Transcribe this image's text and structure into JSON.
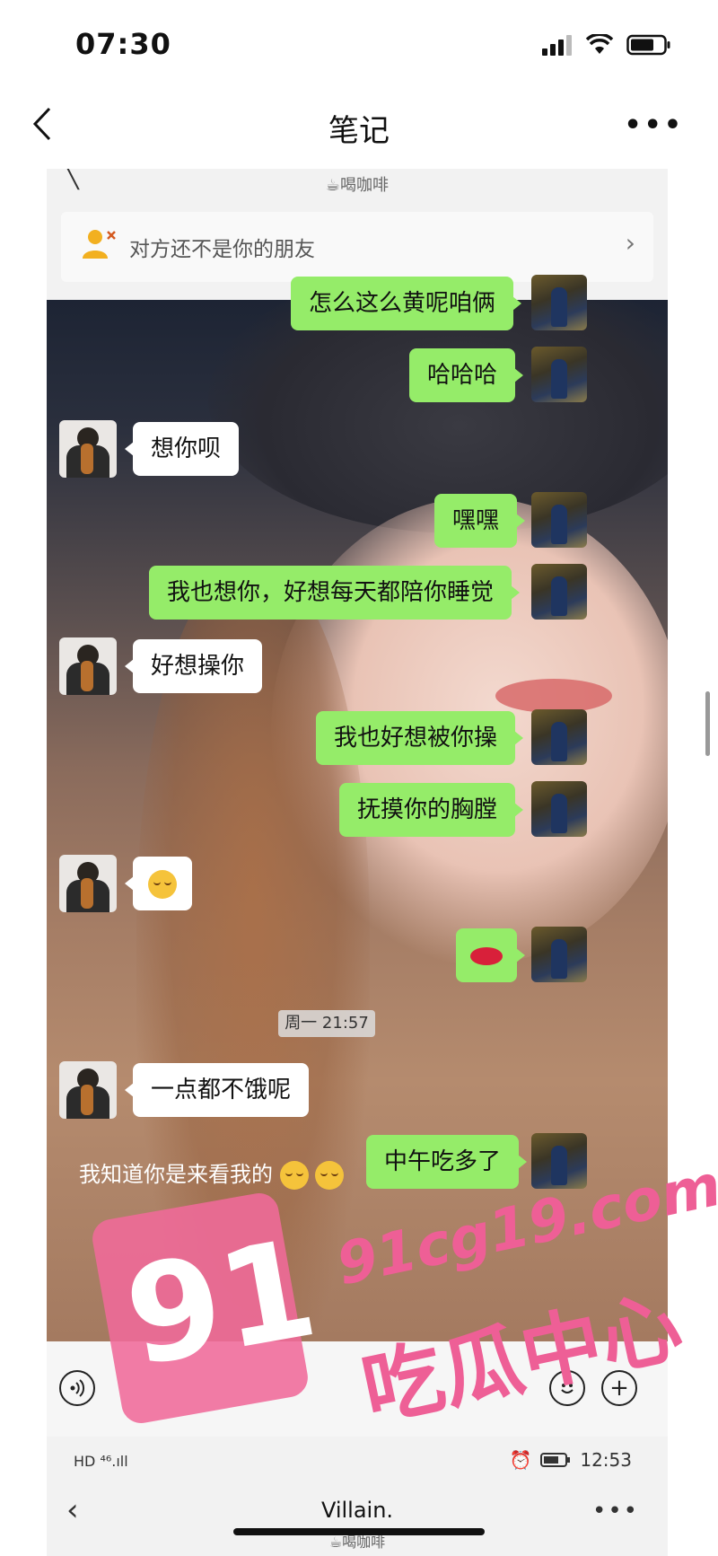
{
  "status": {
    "time": "07:30"
  },
  "nav": {
    "title": "笔记"
  },
  "shot": {
    "sub_title": "☕喝咖啡",
    "notice": "对方还不是你的朋友",
    "time_label": "周一 21:57",
    "overlay_text": "我知道你是来看我的",
    "messages": [
      {
        "side": "right",
        "text": "怎么这么黄呢咱俩"
      },
      {
        "side": "right",
        "text": "哈哈哈"
      },
      {
        "side": "left",
        "text": "想你呗"
      },
      {
        "side": "right",
        "text": "嘿嘿"
      },
      {
        "side": "right",
        "text": "我也想你，好想每天都陪你睡觉"
      },
      {
        "side": "left",
        "text": "好想操你"
      },
      {
        "side": "right",
        "text": "我也好想被你操"
      },
      {
        "side": "right",
        "text": "抚摸你的胸膛"
      },
      {
        "side": "left",
        "text": ""
      },
      {
        "side": "right",
        "text": ""
      },
      {
        "side": "left",
        "text": "一点都不饿呢"
      },
      {
        "side": "right",
        "text": "中午吃多了"
      }
    ]
  },
  "shot2": {
    "status_left": "HD ⁴⁶.ıll",
    "status_time": "12:53",
    "title": "Villain.",
    "sub_title": "☕喝咖啡"
  },
  "watermark": {
    "big": "91",
    "url": "91cg19.com",
    "cn": "吃瓜中心"
  },
  "colors": {
    "bubble_green": "#95ec69",
    "watermark_pink": "#ee5f96"
  }
}
